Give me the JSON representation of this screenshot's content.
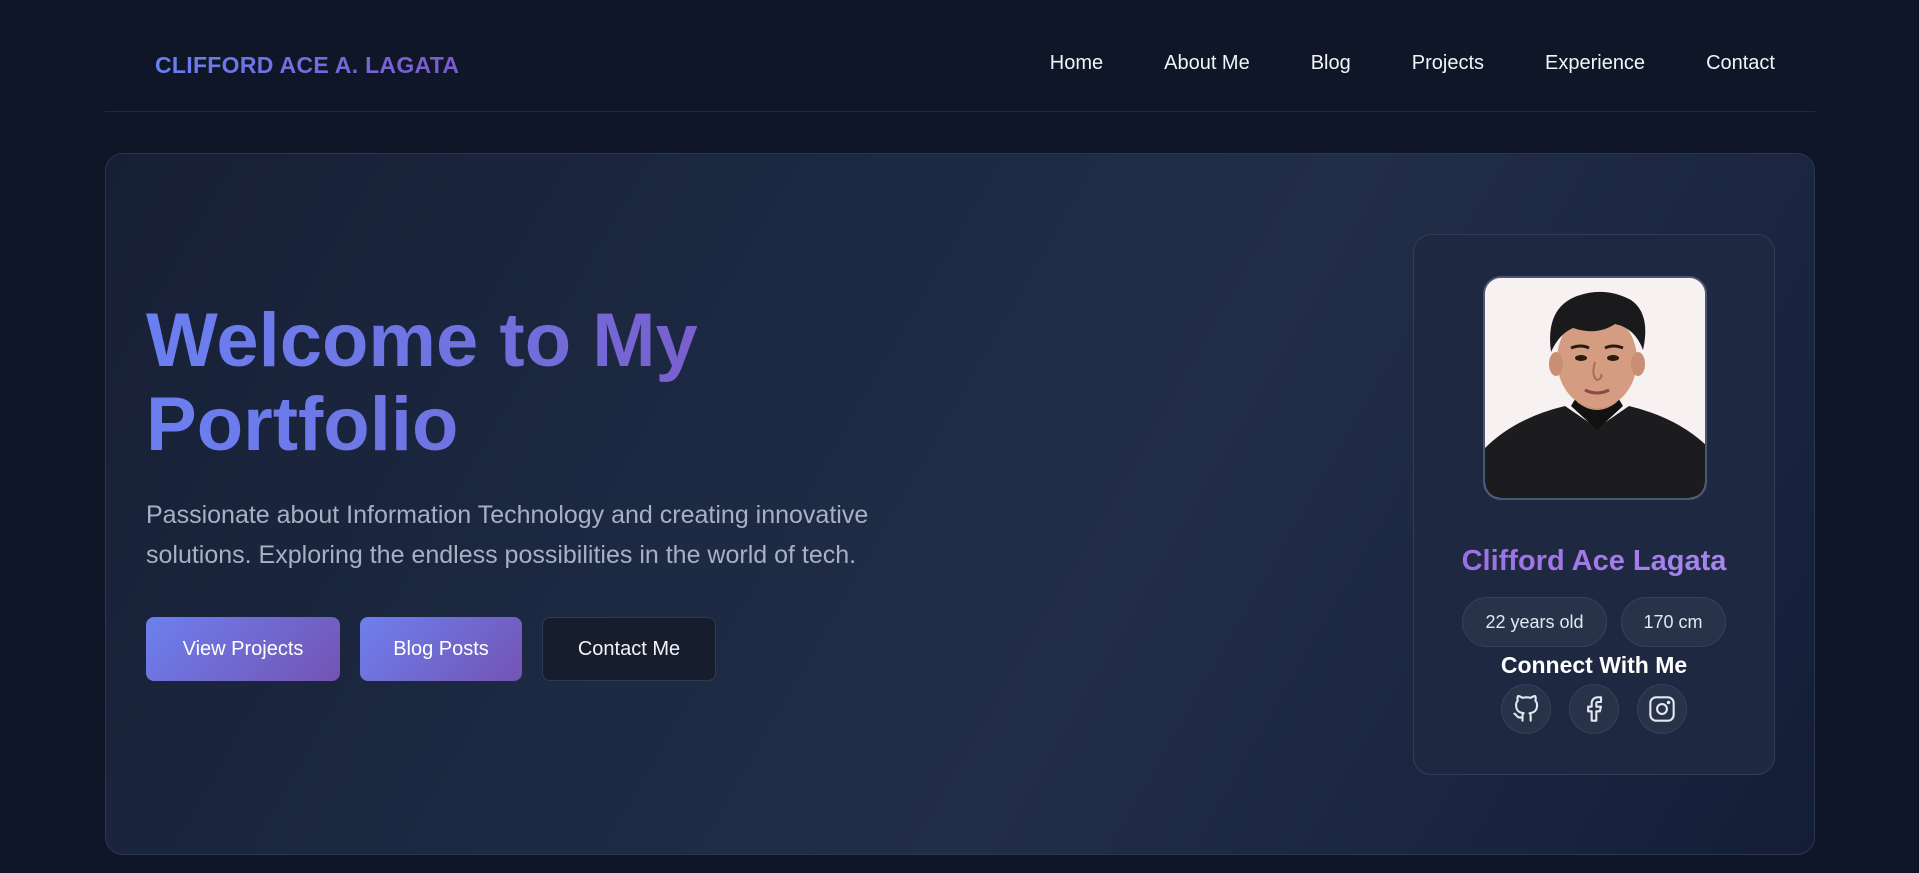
{
  "nav": {
    "brand": "CLIFFORD ACE A. LAGATA",
    "links": [
      "Home",
      "About Me",
      "Blog",
      "Projects",
      "Experience",
      "Contact"
    ]
  },
  "hero": {
    "title": "Welcome to My Portfolio",
    "description": "Passionate about Information Technology and creating innovative solutions. Exploring the endless possibilities in the world of tech.",
    "buttons": {
      "view_projects": "View Projects",
      "blog_posts": "Blog Posts",
      "contact_me": "Contact Me"
    }
  },
  "profile": {
    "name": "Clifford Ace Lagata",
    "age": "22 years old",
    "height": "170 cm",
    "connect_title": "Connect With Me",
    "socials": [
      "github-icon",
      "facebook-icon",
      "instagram-icon"
    ]
  },
  "colors": {
    "background": "#0e1628",
    "accent_start": "#6b7ff0",
    "accent_end": "#7a5bc9",
    "card": "#1e2840"
  }
}
